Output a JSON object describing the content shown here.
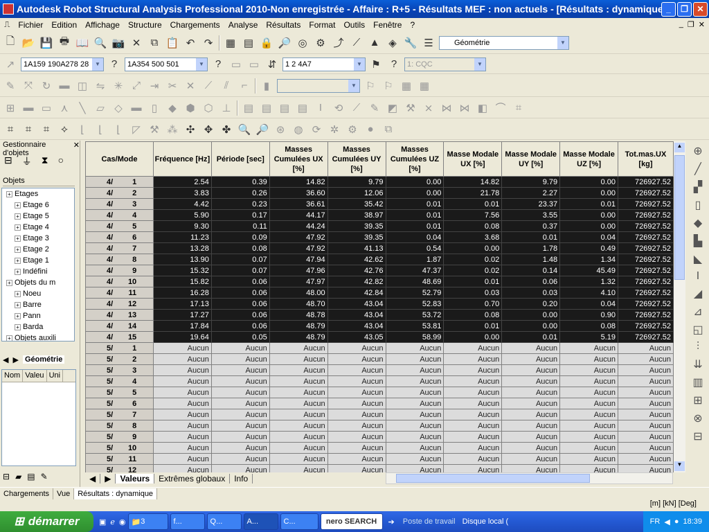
{
  "window": {
    "title": "Autodesk Robot Structural Analysis Professional 2010-Non enregistrée - Affaire : R+5 - Résultats MEF : non actuels - [Résultats : dynamique - Cas: ..."
  },
  "menu": [
    "Fichier",
    "Edition",
    "Affichage",
    "Structure",
    "Chargements",
    "Analyse",
    "Résultats",
    "Format",
    "Outils",
    "Fenêtre",
    "?"
  ],
  "toolbar": {
    "view_combo": "Géométrie",
    "section_combo": "1A159 190A278 28",
    "section2_combo": "1A354 500 501",
    "cases_combo": "1 2 4A7",
    "cqc_combo": "1: CQC"
  },
  "left_panel": {
    "title": "Gestionnaire d'objets",
    "objects_label": "Objets",
    "tree": [
      {
        "label": "Etages",
        "indent": 1
      },
      {
        "label": "Etage 6",
        "indent": 2
      },
      {
        "label": "Etage 5",
        "indent": 2
      },
      {
        "label": "Etage 4",
        "indent": 2
      },
      {
        "label": "Etage 3",
        "indent": 2
      },
      {
        "label": "Etage 2",
        "indent": 2
      },
      {
        "label": "Etage 1",
        "indent": 2
      },
      {
        "label": "Indéfini",
        "indent": 2
      },
      {
        "label": "Objets du m",
        "indent": 1
      },
      {
        "label": "Noeu",
        "indent": 2
      },
      {
        "label": "Barre",
        "indent": 2
      },
      {
        "label": "Pann",
        "indent": 2
      },
      {
        "label": "Barda",
        "indent": 2
      },
      {
        "label": "Objets auxili",
        "indent": 1
      }
    ],
    "tab_geometry": "Géométrie",
    "props_headers": [
      "Nom",
      "Valeu",
      "Uni"
    ]
  },
  "grid": {
    "headers": [
      "Cas/Mode",
      "Fréquence [Hz]",
      "Période [sec]",
      "Masses Cumulées UX [%]",
      "Masses Cumulées UY [%]",
      "Masses Cumulées UZ [%]",
      "Masse Modale UX [%]",
      "Masse Modale UY [%]",
      "Masse Modale UZ [%]",
      "Tot.mas.UX [kg]"
    ],
    "rows": [
      {
        "cas": "4/",
        "mode": "1",
        "v": [
          "2.54",
          "0.39",
          "14.82",
          "9.79",
          "0.00",
          "14.82",
          "9.79",
          "0.00",
          "726927.52"
        ]
      },
      {
        "cas": "4/",
        "mode": "2",
        "v": [
          "3.83",
          "0.26",
          "36.60",
          "12.06",
          "0.00",
          "21.78",
          "2.27",
          "0.00",
          "726927.52"
        ]
      },
      {
        "cas": "4/",
        "mode": "3",
        "v": [
          "4.42",
          "0.23",
          "36.61",
          "35.42",
          "0.01",
          "0.01",
          "23.37",
          "0.01",
          "726927.52"
        ]
      },
      {
        "cas": "4/",
        "mode": "4",
        "v": [
          "5.90",
          "0.17",
          "44.17",
          "38.97",
          "0.01",
          "7.56",
          "3.55",
          "0.00",
          "726927.52"
        ]
      },
      {
        "cas": "4/",
        "mode": "5",
        "v": [
          "9.30",
          "0.11",
          "44.24",
          "39.35",
          "0.01",
          "0.08",
          "0.37",
          "0.00",
          "726927.52"
        ]
      },
      {
        "cas": "4/",
        "mode": "6",
        "v": [
          "11.23",
          "0.09",
          "47.92",
          "39.35",
          "0.04",
          "3.68",
          "0.01",
          "0.04",
          "726927.52"
        ]
      },
      {
        "cas": "4/",
        "mode": "7",
        "v": [
          "13.28",
          "0.08",
          "47.92",
          "41.13",
          "0.54",
          "0.00",
          "1.78",
          "0.49",
          "726927.52"
        ]
      },
      {
        "cas": "4/",
        "mode": "8",
        "v": [
          "13.90",
          "0.07",
          "47.94",
          "42.62",
          "1.87",
          "0.02",
          "1.48",
          "1.34",
          "726927.52"
        ]
      },
      {
        "cas": "4/",
        "mode": "9",
        "v": [
          "15.32",
          "0.07",
          "47.96",
          "42.76",
          "47.37",
          "0.02",
          "0.14",
          "45.49",
          "726927.52"
        ]
      },
      {
        "cas": "4/",
        "mode": "10",
        "v": [
          "15.82",
          "0.06",
          "47.97",
          "42.82",
          "48.69",
          "0.01",
          "0.06",
          "1.32",
          "726927.52"
        ]
      },
      {
        "cas": "4/",
        "mode": "11",
        "v": [
          "16.28",
          "0.06",
          "48.00",
          "42.84",
          "52.79",
          "0.03",
          "0.03",
          "4.10",
          "726927.52"
        ]
      },
      {
        "cas": "4/",
        "mode": "12",
        "v": [
          "17.13",
          "0.06",
          "48.70",
          "43.04",
          "52.83",
          "0.70",
          "0.20",
          "0.04",
          "726927.52"
        ]
      },
      {
        "cas": "4/",
        "mode": "13",
        "v": [
          "17.27",
          "0.06",
          "48.78",
          "43.04",
          "53.72",
          "0.08",
          "0.00",
          "0.90",
          "726927.52"
        ]
      },
      {
        "cas": "4/",
        "mode": "14",
        "v": [
          "17.84",
          "0.06",
          "48.79",
          "43.04",
          "53.81",
          "0.01",
          "0.00",
          "0.08",
          "726927.52"
        ]
      },
      {
        "cas": "4/",
        "mode": "15",
        "v": [
          "19.64",
          "0.05",
          "48.79",
          "43.05",
          "58.99",
          "0.00",
          "0.01",
          "5.19",
          "726927.52"
        ]
      },
      {
        "cas": "5/",
        "mode": "1",
        "v": [
          "Aucun",
          "Aucun",
          "Aucun",
          "Aucun",
          "Aucun",
          "Aucun",
          "Aucun",
          "Aucun",
          "Aucun"
        ]
      },
      {
        "cas": "5/",
        "mode": "2",
        "v": [
          "Aucun",
          "Aucun",
          "Aucun",
          "Aucun",
          "Aucun",
          "Aucun",
          "Aucun",
          "Aucun",
          "Aucun"
        ]
      },
      {
        "cas": "5/",
        "mode": "3",
        "v": [
          "Aucun",
          "Aucun",
          "Aucun",
          "Aucun",
          "Aucun",
          "Aucun",
          "Aucun",
          "Aucun",
          "Aucun"
        ]
      },
      {
        "cas": "5/",
        "mode": "4",
        "v": [
          "Aucun",
          "Aucun",
          "Aucun",
          "Aucun",
          "Aucun",
          "Aucun",
          "Aucun",
          "Aucun",
          "Aucun"
        ]
      },
      {
        "cas": "5/",
        "mode": "5",
        "v": [
          "Aucun",
          "Aucun",
          "Aucun",
          "Aucun",
          "Aucun",
          "Aucun",
          "Aucun",
          "Aucun",
          "Aucun"
        ]
      },
      {
        "cas": "5/",
        "mode": "6",
        "v": [
          "Aucun",
          "Aucun",
          "Aucun",
          "Aucun",
          "Aucun",
          "Aucun",
          "Aucun",
          "Aucun",
          "Aucun"
        ]
      },
      {
        "cas": "5/",
        "mode": "7",
        "v": [
          "Aucun",
          "Aucun",
          "Aucun",
          "Aucun",
          "Aucun",
          "Aucun",
          "Aucun",
          "Aucun",
          "Aucun"
        ]
      },
      {
        "cas": "5/",
        "mode": "8",
        "v": [
          "Aucun",
          "Aucun",
          "Aucun",
          "Aucun",
          "Aucun",
          "Aucun",
          "Aucun",
          "Aucun",
          "Aucun"
        ]
      },
      {
        "cas": "5/",
        "mode": "9",
        "v": [
          "Aucun",
          "Aucun",
          "Aucun",
          "Aucun",
          "Aucun",
          "Aucun",
          "Aucun",
          "Aucun",
          "Aucun"
        ]
      },
      {
        "cas": "5/",
        "mode": "10",
        "v": [
          "Aucun",
          "Aucun",
          "Aucun",
          "Aucun",
          "Aucun",
          "Aucun",
          "Aucun",
          "Aucun",
          "Aucun"
        ]
      },
      {
        "cas": "5/",
        "mode": "11",
        "v": [
          "Aucun",
          "Aucun",
          "Aucun",
          "Aucun",
          "Aucun",
          "Aucun",
          "Aucun",
          "Aucun",
          "Aucun"
        ]
      },
      {
        "cas": "5/",
        "mode": "12",
        "v": [
          "Aucun",
          "Aucun",
          "Aucun",
          "Aucun",
          "Aucun",
          "Aucun",
          "Aucun",
          "Aucun",
          "Aucun"
        ]
      }
    ],
    "tabs": [
      "Valeurs",
      "Extrêmes globaux",
      "Info"
    ]
  },
  "status": {
    "cells": [
      "Chargements",
      "Vue",
      "Résultats : dynamique"
    ],
    "units": "[m] [kN] [Deg]"
  },
  "taskbar": {
    "start": "démarrer",
    "tasks": [
      "3",
      "f...",
      "Q...",
      "A...",
      "C..."
    ],
    "search": "nero SEARCH",
    "poste": "Poste de travail",
    "disque": "Disque local (",
    "lang": "FR",
    "clock": "18:39"
  },
  "colors": {
    "dark_row": "#1a1a1a",
    "light_row": "#dcdcdc",
    "titlebar": "#0a5fd8"
  }
}
